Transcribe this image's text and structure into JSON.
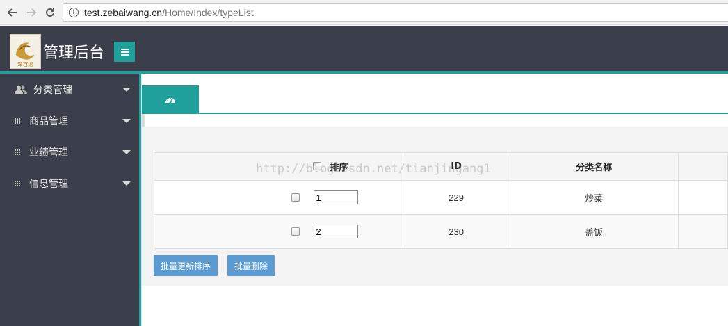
{
  "browser": {
    "url_host": "test.zebaiwang.cn",
    "url_path": "/Home/Index/typeList"
  },
  "header": {
    "brand": "管理后台",
    "logo_text": "泽百通"
  },
  "sidebar": {
    "items": [
      {
        "label": "分类管理",
        "icon": "users-icon"
      },
      {
        "label": "商品管理",
        "icon": "grid-icon"
      },
      {
        "label": "业绩管理",
        "icon": "grid-icon"
      },
      {
        "label": "信息管理",
        "icon": "grid-icon"
      }
    ]
  },
  "tab": {
    "icon": "dashboard-icon"
  },
  "table": {
    "headers": {
      "sort": "排序",
      "id": "ID",
      "name": "分类名称",
      "extra": ""
    },
    "rows": [
      {
        "sort": "1",
        "id": "229",
        "name": "炒菜"
      },
      {
        "sort": "2",
        "id": "230",
        "name": "盖饭"
      }
    ]
  },
  "actions": {
    "batch_sort": "批量更新排序",
    "batch_delete": "批量删除"
  },
  "watermark": "http://blog.csdn.net/tianjingang1",
  "colors": {
    "accent": "#1fa09a",
    "header_bg": "#3a3f4b",
    "button": "#5b9bd1"
  }
}
